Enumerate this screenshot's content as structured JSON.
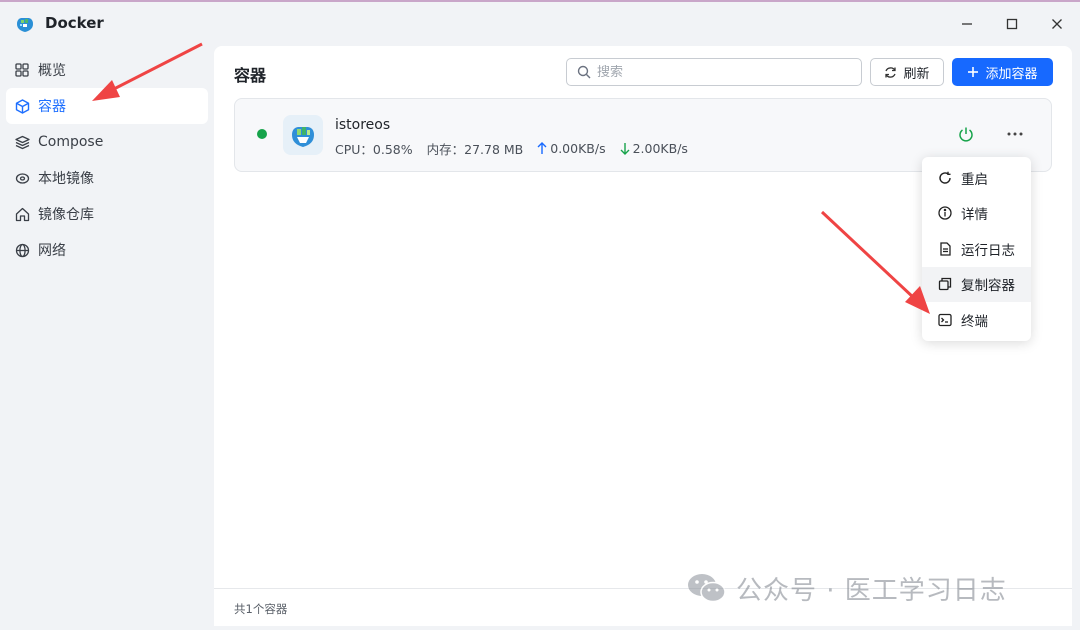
{
  "app": {
    "title": "Docker"
  },
  "window_controls": {
    "minimize": "minimize",
    "maximize": "maximize",
    "close": "close"
  },
  "sidebar": {
    "items": [
      {
        "label": "概览",
        "icon": "grid-icon"
      },
      {
        "label": "容器",
        "icon": "cube-icon",
        "active": true
      },
      {
        "label": "Compose",
        "icon": "layers-icon"
      },
      {
        "label": "本地镜像",
        "icon": "disk-icon"
      },
      {
        "label": "镜像仓库",
        "icon": "home-icon"
      },
      {
        "label": "网络",
        "icon": "globe-icon"
      }
    ]
  },
  "main": {
    "title": "容器",
    "search_placeholder": "搜索",
    "refresh_label": "刷新",
    "add_label": "添加容器"
  },
  "container": {
    "name": "istoreos",
    "status": "running",
    "cpu_label": "CPU：0.58%",
    "mem_label": "内存：27.78 MB",
    "upload": "0.00KB/s",
    "download": "2.00KB/s"
  },
  "menu": {
    "items": [
      {
        "label": "重启",
        "icon": "restart-icon"
      },
      {
        "label": "详情",
        "icon": "info-icon"
      },
      {
        "label": "运行日志",
        "icon": "log-icon"
      },
      {
        "label": "复制容器",
        "icon": "copy-icon",
        "hover": true
      },
      {
        "label": "终端",
        "icon": "terminal-icon"
      }
    ]
  },
  "footer": {
    "count_text": "共1个容器"
  },
  "watermark": {
    "text": "公众号 · 医工学习日志"
  },
  "colors": {
    "accent": "#1769ff",
    "running": "#16a34a",
    "arrow": "#ef4444"
  }
}
